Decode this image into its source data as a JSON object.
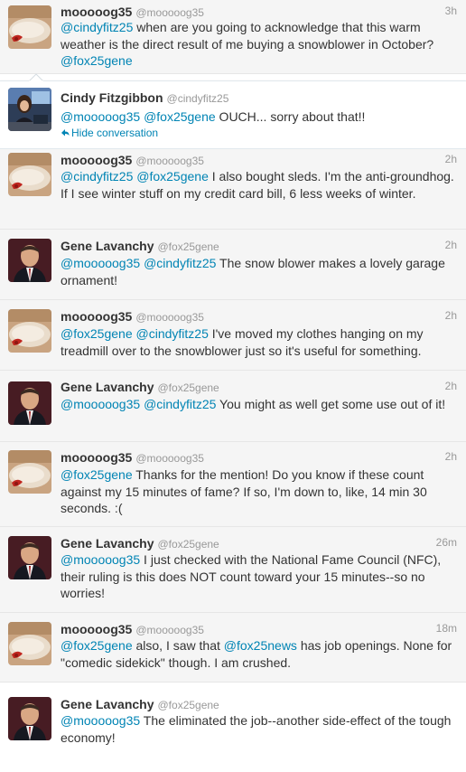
{
  "colors": {
    "link": "#0084b4",
    "meta": "#999999",
    "name": "#333333"
  },
  "conversation": {
    "hide_label": "Hide conversation",
    "tweets": [
      {
        "fullname": "mooooog35",
        "screen_name": "@mooooog35",
        "time": "3h",
        "avatar": "pillow-avatar",
        "text": [
          {
            "mention": "@cindyfitz25"
          },
          {
            "text": " when are you going to acknowledge that this warm weather is the direct result of me buying a snowblower in October? "
          },
          {
            "mention": "@fox25gene"
          }
        ]
      },
      {
        "fullname": "Cindy Fitzgibbon",
        "screen_name": "@cindyfitz25",
        "time": "",
        "avatar": "anchor-desk-avatar",
        "text": [
          {
            "mention": "@mooooog35"
          },
          {
            "text": " "
          },
          {
            "mention": "@fox25gene"
          },
          {
            "text": " OUCH... sorry about that!!"
          }
        ]
      },
      {
        "fullname": "mooooog35",
        "screen_name": "@mooooog35",
        "time": "2h",
        "avatar": "pillow-avatar",
        "text": [
          {
            "mention": "@cindyfitz25"
          },
          {
            "text": " "
          },
          {
            "mention": "@fox25gene"
          },
          {
            "text": " I also bought sleds. I'm the anti-groundhog. If I see winter stuff on my credit card bill, 6 less weeks of winter."
          }
        ]
      },
      {
        "fullname": "Gene Lavanchy",
        "screen_name": "@fox25gene",
        "time": "2h",
        "avatar": "suit-man-avatar",
        "text": [
          {
            "mention": "@mooooog35"
          },
          {
            "text": " "
          },
          {
            "mention": "@cindyfitz25"
          },
          {
            "text": " The snow blower makes a lovely garage ornament!"
          }
        ]
      },
      {
        "fullname": "mooooog35",
        "screen_name": "@mooooog35",
        "time": "2h",
        "avatar": "pillow-avatar",
        "text": [
          {
            "mention": "@fox25gene"
          },
          {
            "text": " "
          },
          {
            "mention": "@cindyfitz25"
          },
          {
            "text": " I've moved my clothes hanging on my treadmill over to the snowblower just so it's useful for something."
          }
        ]
      },
      {
        "fullname": "Gene Lavanchy",
        "screen_name": "@fox25gene",
        "time": "2h",
        "avatar": "suit-man-avatar",
        "text": [
          {
            "mention": "@mooooog35"
          },
          {
            "text": " "
          },
          {
            "mention": "@cindyfitz25"
          },
          {
            "text": " You might as well get some use out of it!"
          }
        ]
      },
      {
        "fullname": "mooooog35",
        "screen_name": "@mooooog35",
        "time": "2h",
        "avatar": "pillow-avatar",
        "text": [
          {
            "mention": "@fox25gene"
          },
          {
            "text": " Thanks for the mention! Do you know if these count against my 15 minutes of fame? If so, I'm down to, like, 14 min 30 seconds. :("
          }
        ]
      },
      {
        "fullname": "Gene Lavanchy",
        "screen_name": "@fox25gene",
        "time": "26m",
        "avatar": "suit-man-avatar",
        "text": [
          {
            "mention": "@mooooog35"
          },
          {
            "text": " I just checked with the National Fame Council (NFC), their ruling is this does NOT count toward your 15 minutes--so no worries!"
          }
        ]
      },
      {
        "fullname": "mooooog35",
        "screen_name": "@mooooog35",
        "time": "18m",
        "avatar": "pillow-avatar",
        "text": [
          {
            "mention": "@fox25gene"
          },
          {
            "text": " also, I saw that "
          },
          {
            "mention": "@fox25news"
          },
          {
            "text": " has job openings. None for \"comedic sidekick\" though. I am crushed."
          }
        ]
      },
      {
        "fullname": "Gene Lavanchy",
        "screen_name": "@fox25gene",
        "time": "",
        "avatar": "suit-man-avatar",
        "text": [
          {
            "mention": "@mooooog35"
          },
          {
            "text": " The eliminated the job--another side-effect of the tough economy!"
          }
        ]
      }
    ]
  }
}
